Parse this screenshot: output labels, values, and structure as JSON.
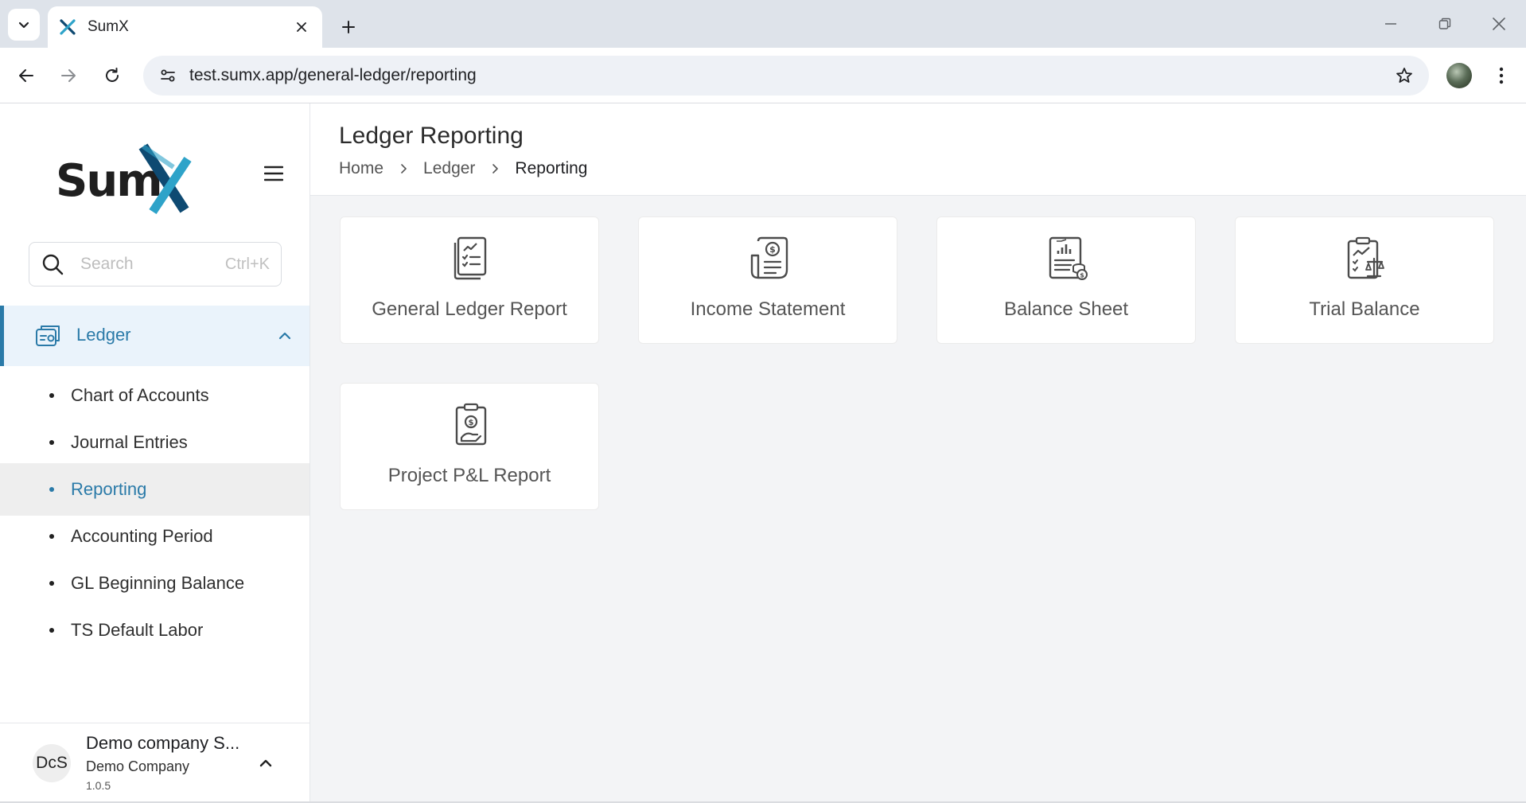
{
  "browser": {
    "tab_title": "SumX",
    "url": "test.sumx.app/general-ledger/reporting"
  },
  "sidebar": {
    "logo_text": "SumX",
    "search": {
      "placeholder": "Search",
      "shortcut": "Ctrl+K"
    },
    "parent": {
      "label": "Ledger",
      "expanded": true
    },
    "items": [
      {
        "label": "Chart of Accounts",
        "active": false
      },
      {
        "label": "Journal Entries",
        "active": false
      },
      {
        "label": "Reporting",
        "active": true
      },
      {
        "label": "Accounting Period",
        "active": false
      },
      {
        "label": "GL Beginning Balance",
        "active": false
      },
      {
        "label": "TS Default Labor",
        "active": false
      }
    ],
    "company": {
      "initials": "DcS",
      "name": "Demo company S...",
      "subtitle": "Demo Company",
      "version": "1.0.5"
    }
  },
  "page": {
    "title": "Ledger Reporting",
    "breadcrumb": [
      "Home",
      "Ledger",
      "Reporting"
    ]
  },
  "cards": [
    {
      "label": "General Ledger Report",
      "icon": "report-checklist-icon"
    },
    {
      "label": "Income Statement",
      "icon": "income-statement-icon"
    },
    {
      "label": "Balance Sheet",
      "icon": "balance-sheet-icon"
    },
    {
      "label": "Trial Balance",
      "icon": "trial-balance-icon"
    },
    {
      "label": "Project P&L Report",
      "icon": "project-pl-icon"
    }
  ],
  "colors": {
    "accent": "#2a7aa8",
    "logo_dark": "#1f1f1f",
    "logo_x_light": "#2ea3c9",
    "logo_x_dark": "#0e4a72"
  }
}
